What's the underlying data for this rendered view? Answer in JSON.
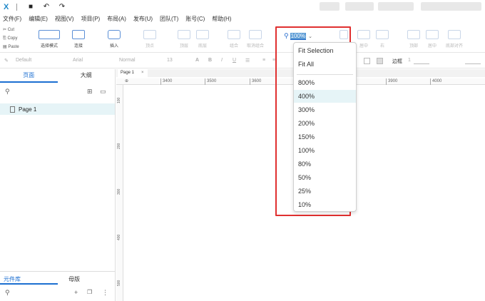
{
  "titlebar": {
    "logo": "X",
    "save_icon": "save-icon",
    "undo_icon": "undo-icon",
    "redo_icon": "redo-icon"
  },
  "menu": [
    "文件(F)",
    "编辑(E)",
    "视图(V)",
    "项目(P)",
    "布局(A)",
    "发布(U)",
    "团队(T)",
    "账号(C)",
    "帮助(H)"
  ],
  "clipboard": {
    "cut": "Cut",
    "copy": "Copy",
    "paste": "Paste"
  },
  "toolbar": {
    "select_mode": "选择模式",
    "connect": "连接",
    "insert": "插入",
    "point": "顶点",
    "top_layer": "顶层",
    "bottom_layer": "底层",
    "group": "组合",
    "ungroup": "取消组合",
    "left": "左",
    "middle": "居中",
    "right": "右",
    "top": "顶部",
    "v_middle": "居中",
    "bottom": "底部对齐"
  },
  "zoom": {
    "value": "100%"
  },
  "format": {
    "style": "Default",
    "font": "Arial",
    "weight": "Normal",
    "size": "13",
    "fill_label": "填充",
    "border_label": "边框",
    "border_value": "1"
  },
  "left_panel": {
    "tab_pages": "页面",
    "tab_outline": "大纲",
    "page_name": "Page 1",
    "lib_tab": "元件库",
    "master_tab": "母版"
  },
  "canvas": {
    "tab": "Page 1",
    "ruler_x": [
      "3400",
      "3500",
      "3600",
      "3800",
      "3900",
      "4000"
    ],
    "ruler_y": [
      "100",
      "200",
      "300",
      "400",
      "500"
    ]
  },
  "dropdown": {
    "options": [
      "Fit Selection",
      "Fit All",
      "800%",
      "400%",
      "300%",
      "200%",
      "150%",
      "100%",
      "80%",
      "50%",
      "25%",
      "10%"
    ],
    "selected": "400%"
  }
}
